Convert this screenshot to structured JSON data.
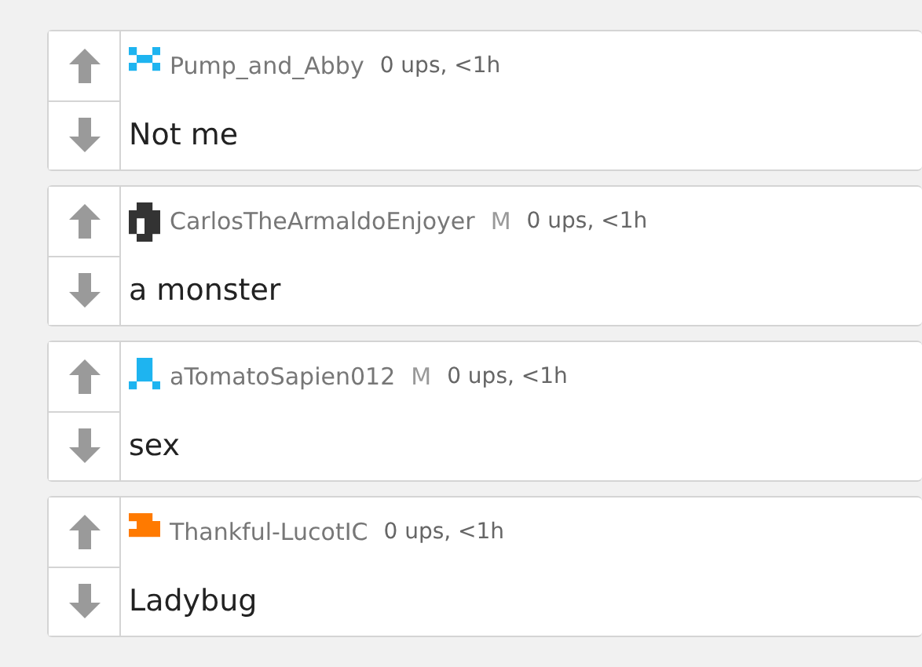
{
  "comments": [
    {
      "username": "Pump_and_Abby",
      "color": "#1eb4f0",
      "meta": "0 ups, <1h",
      "text": "Not me"
    },
    {
      "username": "CarlosTheArmaldoEnjoyer",
      "color": "#333333",
      "badge": "M",
      "meta": "0 ups, <1h",
      "text": "a monster"
    },
    {
      "username": "aTomatoSapien012",
      "color": "#1eb4f0",
      "badge": "M",
      "meta": "0 ups, <1h",
      "text": "sex"
    },
    {
      "username": "Thankful-LucotIC",
      "color": "#ff7a00",
      "meta": "0 ups, <1h",
      "text": "Ladybug"
    }
  ]
}
